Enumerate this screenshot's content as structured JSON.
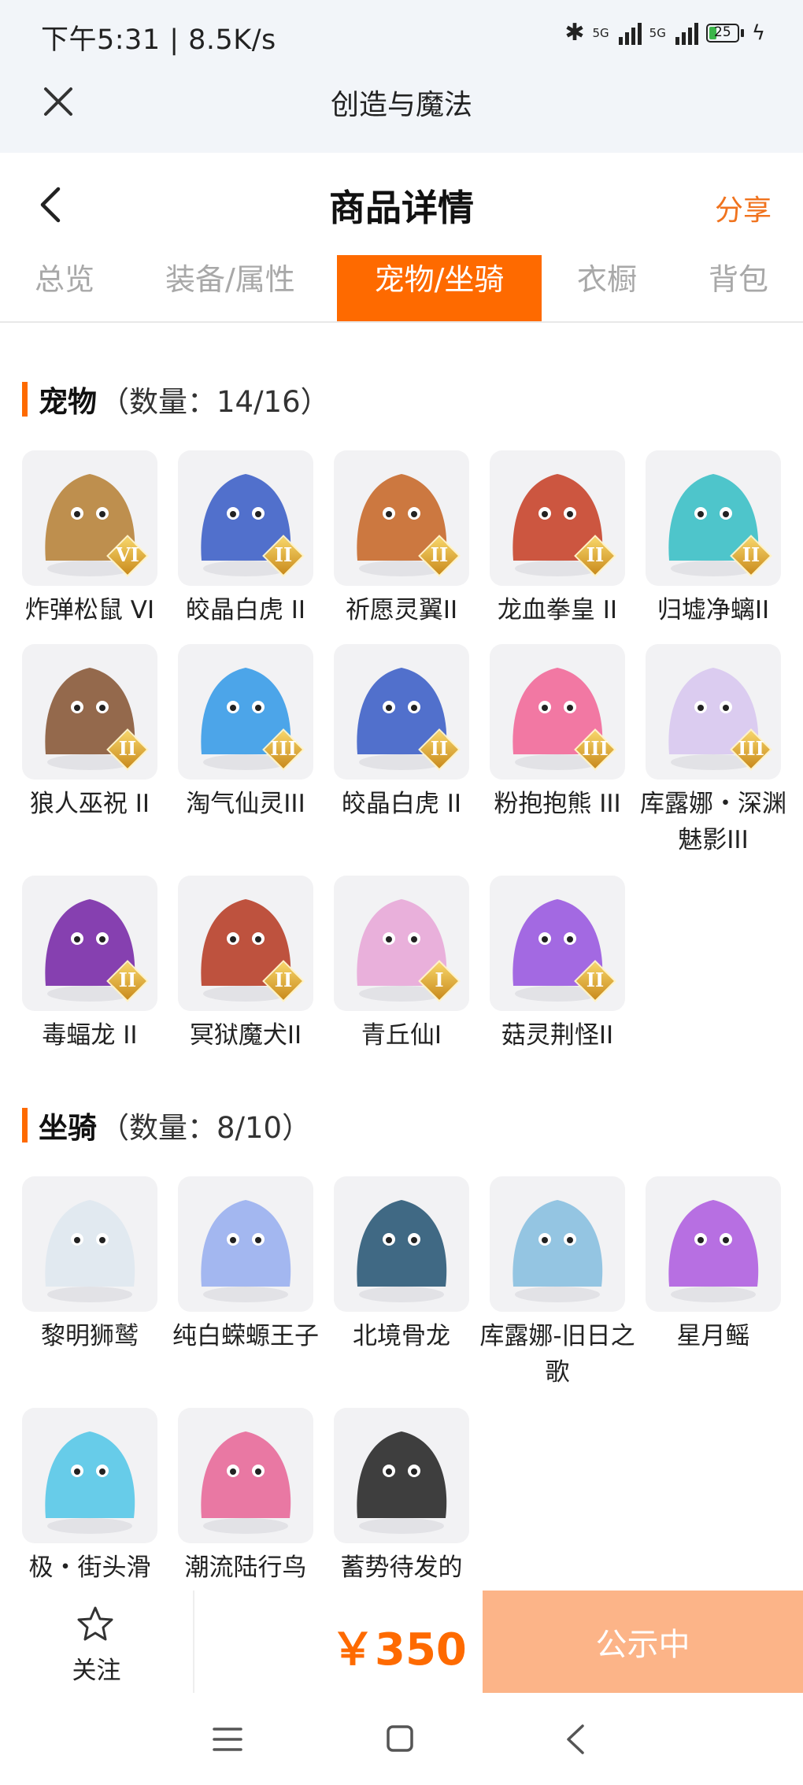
{
  "status_bar": {
    "time": "下午5:31 | 8.5K/s",
    "network_1": "5G",
    "network_2": "5G",
    "battery": "25"
  },
  "app_bar": {
    "title": "创造与魔法",
    "close_icon": "close-icon"
  },
  "header": {
    "title": "商品详情",
    "share_label": "分享",
    "back_icon": "chevron-left-icon"
  },
  "tabs": [
    {
      "label": "总览",
      "active": false
    },
    {
      "label": "装备/属性",
      "active": false
    },
    {
      "label": "宠物/坐骑",
      "active": true
    },
    {
      "label": "衣橱",
      "active": false
    },
    {
      "label": "背包",
      "active": false
    }
  ],
  "pets": {
    "title": "宠物",
    "count": "（数量：14/16）",
    "items": [
      {
        "name": "炸弹松鼠 VI",
        "badge": "VI",
        "color": "#b8843c"
      },
      {
        "name": "皎晶白虎 II",
        "badge": "II",
        "color": "#3f62c8"
      },
      {
        "name": "祈愿灵翼II",
        "badge": "II",
        "color": "#c86a2c"
      },
      {
        "name": "龙血拳皇 II",
        "badge": "II",
        "color": "#c8452c"
      },
      {
        "name": "归墟净螭II",
        "badge": "II",
        "color": "#3cc0c6"
      },
      {
        "name": "狼人巫祝 II",
        "badge": "II",
        "color": "#8a5a3a"
      },
      {
        "name": "淘气仙灵III",
        "badge": "III",
        "color": "#3a9ce8"
      },
      {
        "name": "皎晶白虎 II",
        "badge": "II",
        "color": "#3f62c8"
      },
      {
        "name": "粉抱抱熊 III",
        "badge": "III",
        "color": "#f26a9a"
      },
      {
        "name": "库露娜・深渊魅影III",
        "badge": "III",
        "color": "#d8c8f0"
      },
      {
        "name": "毒蝠龙 II",
        "badge": "II",
        "color": "#7a2ca8"
      },
      {
        "name": "冥狱魔犬II",
        "badge": "II",
        "color": "#b8402a"
      },
      {
        "name": "青丘仙I",
        "badge": "I",
        "color": "#e8a8d8"
      },
      {
        "name": "菇灵荆怪II",
        "badge": "II",
        "color": "#9a5ae0"
      }
    ]
  },
  "mounts": {
    "title": "坐骑",
    "count": "（数量：8/10）",
    "items": [
      {
        "name": "黎明狮鹫",
        "color": "#dfe8f0"
      },
      {
        "name": "纯白蝾螈王子",
        "color": "#9ab0f0"
      },
      {
        "name": "北境骨龙",
        "color": "#2c5a78"
      },
      {
        "name": "库露娜-旧日之歌",
        "color": "#8ac0e0"
      },
      {
        "name": "星月鳐",
        "color": "#b060e0"
      },
      {
        "name": "极・街头滑",
        "color": "#58c8e8"
      },
      {
        "name": "潮流陆行鸟",
        "color": "#e86a9a"
      },
      {
        "name": "蓄势待发的",
        "color": "#2a2a2a"
      }
    ]
  },
  "footer": {
    "follow_label": "关注",
    "price": "￥350",
    "status_label": "公示中"
  },
  "colors": {
    "accent": "#fe6a00",
    "share": "#f0731e",
    "status_button": "#fcb488"
  }
}
